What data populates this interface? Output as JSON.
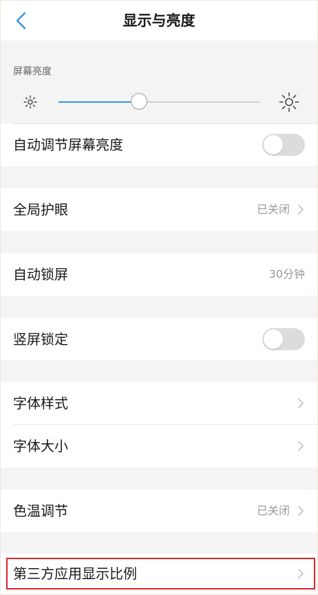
{
  "header": {
    "title": "显示与亮度",
    "back_icon": "chevron-left-icon",
    "accent_color": "#3a8ee6"
  },
  "brightness": {
    "section_label": "屏幕亮度",
    "level_percent": 40,
    "min_icon": "sun-small-icon",
    "max_icon": "sun-large-icon"
  },
  "rows": {
    "auto_brightness": {
      "label": "自动调节屏幕亮度",
      "toggle_on": false
    },
    "eye_protection": {
      "label": "全局护眼",
      "value": "已关闭"
    },
    "auto_lock": {
      "label": "自动锁屏",
      "value": "30分钟"
    },
    "portrait_lock": {
      "label": "竖屏锁定",
      "toggle_on": false
    },
    "font_style": {
      "label": "字体样式"
    },
    "font_size": {
      "label": "字体大小"
    },
    "color_temp": {
      "label": "色温调节",
      "value": "已关闭"
    },
    "third_party_ratio": {
      "label": "第三方应用显示比例",
      "highlight_color": "#d6232a"
    }
  }
}
